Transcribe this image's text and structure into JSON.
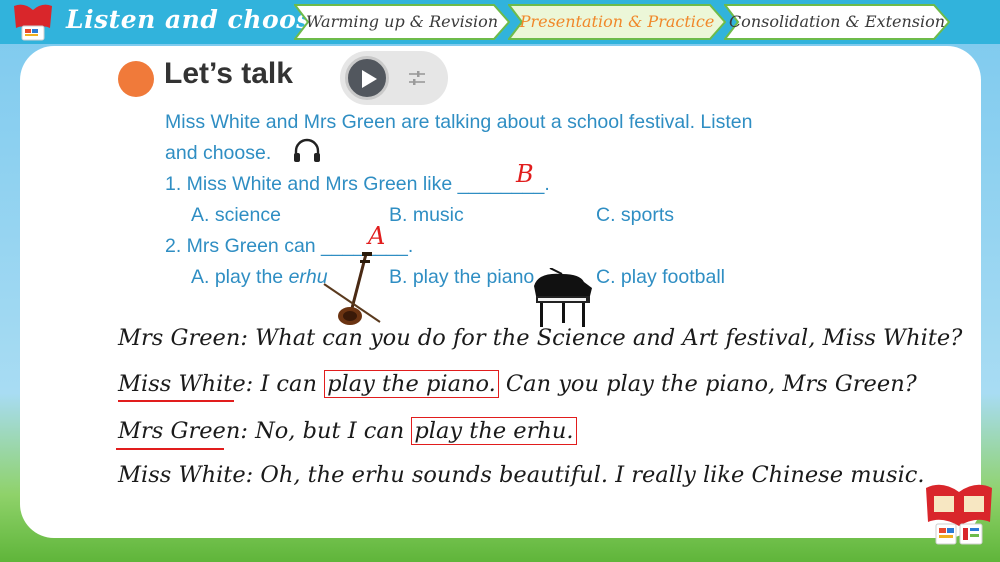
{
  "header": {
    "title": "Listen and choose",
    "steps": [
      {
        "label": "Warming up & Revision",
        "active": false
      },
      {
        "label": "Presentation & Practice",
        "active": true
      },
      {
        "label": "Consolidation & Extension",
        "active": false
      }
    ]
  },
  "section": {
    "heading": "Let’s talk"
  },
  "instruction": {
    "line1": "Miss White and Mrs Green are talking about a school festival. Listen",
    "line2": "and choose."
  },
  "questions": [
    {
      "prompt": "1. Miss White and Mrs Green like ________.",
      "options": [
        "A. science",
        "B. music",
        "C. sports"
      ],
      "handwritten_answer": "B"
    },
    {
      "prompt": "2. Mrs Green can ________.",
      "option_a_prefix": "A. play the ",
      "option_a_italic": "erhu",
      "options": [
        "B. play the piano",
        "C. play football"
      ],
      "handwritten_answer": "A"
    }
  ],
  "dialogue": [
    {
      "speaker": "Mrs Green",
      "text": ": What can you do for the Science and Art festival, Miss White?"
    },
    {
      "speaker": "Miss White",
      "text_before": ": I can ",
      "highlight": "play the piano.",
      "text_after": " Can you play the piano, Mrs Green?"
    },
    {
      "speaker": "Mrs Green",
      "text_before": ": No, but I can ",
      "highlight": "play the erhu."
    },
    {
      "speaker": "Miss White",
      "text": ": Oh, the erhu sounds beautiful. I really like Chinese music."
    }
  ],
  "icons": {
    "play": "play-icon",
    "settings": "sliders-icon",
    "headphones": "headphones-icon"
  },
  "colors": {
    "header_bg": "#31b3dc",
    "active_step_text": "#f0882a",
    "task_text": "#2f8ec3",
    "annotation": "#e11d1d",
    "bullet": "#f07a3a"
  }
}
